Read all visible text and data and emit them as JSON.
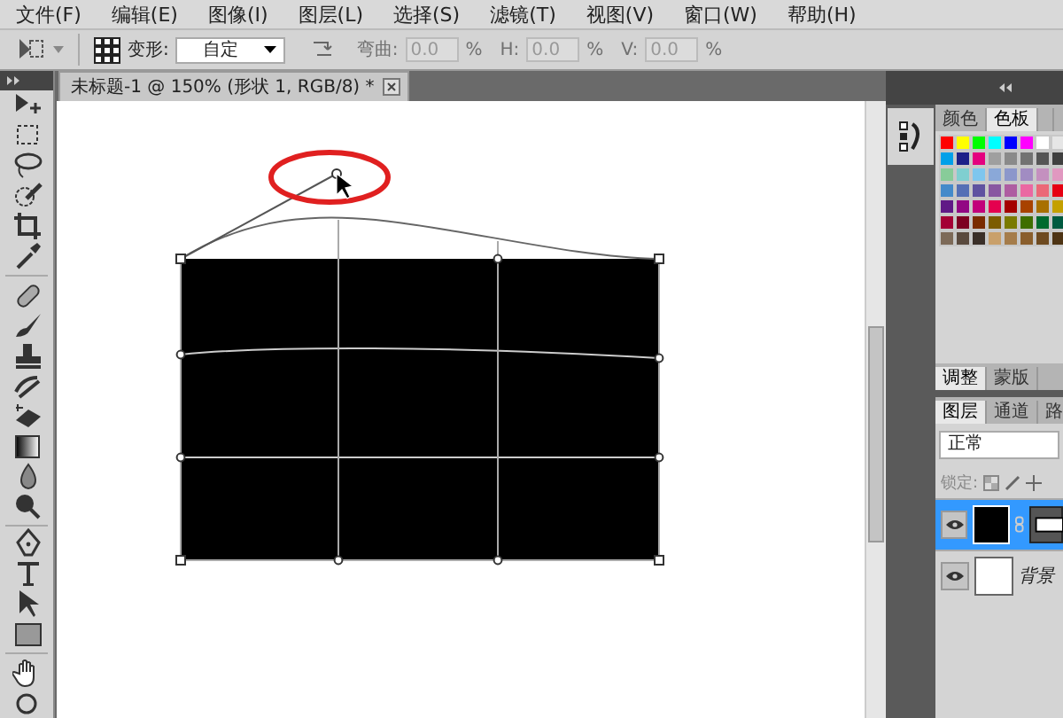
{
  "menu": [
    {
      "label": "文件(F)"
    },
    {
      "label": "编辑(E)"
    },
    {
      "label": "图像(I)"
    },
    {
      "label": "图层(L)"
    },
    {
      "label": "选择(S)"
    },
    {
      "label": "滤镜(T)"
    },
    {
      "label": "视图(V)"
    },
    {
      "label": "窗口(W)"
    },
    {
      "label": "帮助(H)"
    }
  ],
  "options_bar": {
    "warp_label": "变形:",
    "warp_style": "自定",
    "fields": [
      {
        "label": "弯曲:",
        "value": "0.0",
        "unit": "%",
        "disabled": true
      },
      {
        "label": "H:",
        "value": "0.0",
        "unit": "%",
        "disabled": true
      },
      {
        "label": "V:",
        "value": "0.0",
        "unit": "%",
        "disabled": true
      }
    ]
  },
  "document_tab": {
    "title": "未标题-1 @ 150% (形状 1, RGB/8) *"
  },
  "swatches_panel": {
    "tabs": [
      {
        "label": "颜色",
        "selected": false
      },
      {
        "label": "色板",
        "selected": true
      }
    ],
    "swatches": [
      {
        "color": "#ff0000"
      },
      {
        "color": "#ffff00"
      },
      {
        "color": "#00ff00"
      },
      {
        "color": "#00ffff"
      },
      {
        "color": "#0000ff"
      },
      {
        "color": "#ff00ff"
      },
      {
        "color": "#ffffff"
      },
      {
        "color": "#e6e6e6"
      },
      {
        "color": "#00a0e9"
      },
      {
        "color": "#1d2088"
      },
      {
        "color": "#e4007f"
      },
      {
        "color": "#9f9f9f"
      },
      {
        "color": "#8a8a8a"
      },
      {
        "color": "#727272"
      },
      {
        "color": "#555555"
      },
      {
        "color": "#404040"
      },
      {
        "color": "#88cc99"
      },
      {
        "color": "#7fcfd0"
      },
      {
        "color": "#7ec6ee"
      },
      {
        "color": "#8aa8d8"
      },
      {
        "color": "#8c97cb"
      },
      {
        "color": "#a18cc2"
      },
      {
        "color": "#c490bf"
      },
      {
        "color": "#e198c0"
      },
      {
        "color": "#448aca"
      },
      {
        "color": "#556fb5"
      },
      {
        "color": "#5f52a0"
      },
      {
        "color": "#8957a1"
      },
      {
        "color": "#ae5da1"
      },
      {
        "color": "#ea68a2"
      },
      {
        "color": "#eb6877"
      },
      {
        "color": "#e60012"
      },
      {
        "color": "#601986"
      },
      {
        "color": "#920783"
      },
      {
        "color": "#c2007a"
      },
      {
        "color": "#e5004f"
      },
      {
        "color": "#a40000"
      },
      {
        "color": "#a84200"
      },
      {
        "color": "#a87000"
      },
      {
        "color": "#c4a000"
      },
      {
        "color": "#a40035"
      },
      {
        "color": "#7d0022"
      },
      {
        "color": "#7a2c00"
      },
      {
        "color": "#7c5c00"
      },
      {
        "color": "#7a7a00"
      },
      {
        "color": "#3f6e00"
      },
      {
        "color": "#006a2e"
      },
      {
        "color": "#005a40"
      },
      {
        "color": "#7d6a58"
      },
      {
        "color": "#5a4a3e"
      },
      {
        "color": "#3a2f28"
      },
      {
        "color": "#c9a06a"
      },
      {
        "color": "#a57c4a"
      },
      {
        "color": "#8a5e2c"
      },
      {
        "color": "#6e4a20"
      },
      {
        "color": "#4e3414"
      }
    ]
  },
  "adjust_tabs": [
    {
      "label": "调整",
      "selected": true
    },
    {
      "label": "蒙版",
      "selected": false
    }
  ],
  "layers_panel": {
    "tabs": [
      {
        "label": "图层",
        "selected": true
      },
      {
        "label": "通道",
        "selected": false
      },
      {
        "label": "路",
        "selected": false
      }
    ],
    "blend_mode": "正常",
    "lock_label": "锁定:",
    "layers": [
      {
        "kind": "shape",
        "visible": true,
        "selected": true
      },
      {
        "kind": "image",
        "name": "背景",
        "visible": true,
        "selected": false
      }
    ]
  }
}
